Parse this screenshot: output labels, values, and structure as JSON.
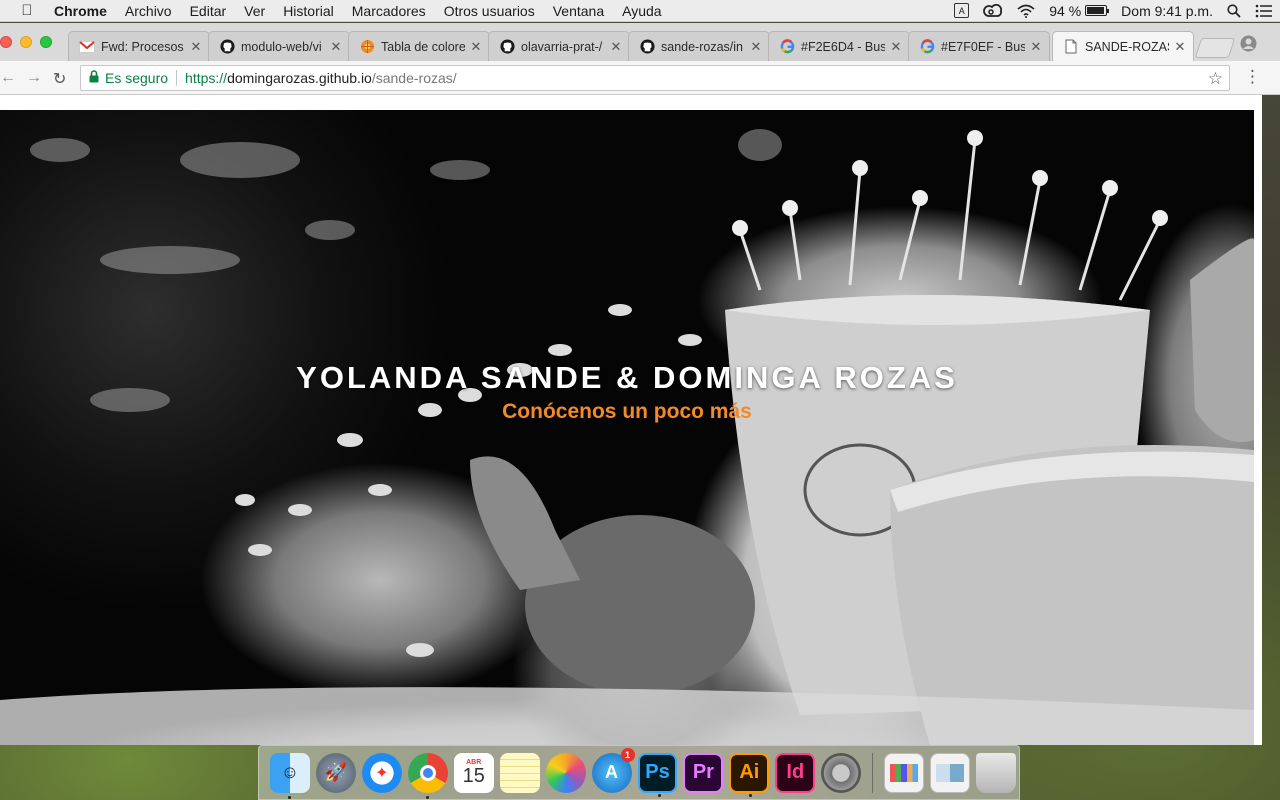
{
  "menubar": {
    "app_name": "Chrome",
    "items": [
      "Archivo",
      "Editar",
      "Ver",
      "Historial",
      "Marcadores",
      "Otros usuarios",
      "Ventana",
      "Ayuda"
    ],
    "battery_percent_label": "94 %",
    "battery_level": 0.94,
    "clock": "Dom 9:41 p.m."
  },
  "tabs": [
    {
      "label": "Fwd: Procesos",
      "favicon": "gmail-icon",
      "active": false
    },
    {
      "label": "modulo-web/vi",
      "favicon": "github-icon",
      "active": false
    },
    {
      "label": "Tabla de colore",
      "favicon": "color-wheel-icon",
      "active": false
    },
    {
      "label": "olavarria-prat-/",
      "favicon": "github-icon",
      "active": false
    },
    {
      "label": "sande-rozas/in",
      "favicon": "github-icon",
      "active": false
    },
    {
      "label": "#F2E6D4 - Bus",
      "favicon": "google-icon",
      "active": false
    },
    {
      "label": "#E7F0EF - Busc",
      "favicon": "google-icon",
      "active": false
    },
    {
      "label": "SANDE-ROZAS",
      "favicon": "page-icon",
      "active": true
    }
  ],
  "omnibox": {
    "secure_label": "Es seguro",
    "url_scheme": "https://",
    "url_host": "domingarozas.github.io",
    "url_path": "/sande-rozas/"
  },
  "page": {
    "hero_title": "YOLANDA SANDE & DOMINGA ROZAS",
    "hero_subtitle": "Conócenos un poco más"
  },
  "dock": {
    "calendar_month": "ABR",
    "calendar_day": "15",
    "appstore_badge": "1",
    "ps_label": "Ps",
    "pr_label": "Pr",
    "ai_label": "Ai",
    "id_label": "Id"
  },
  "colors": {
    "accent_orange": "#f38a2a",
    "secure_green": "#0b8043"
  }
}
